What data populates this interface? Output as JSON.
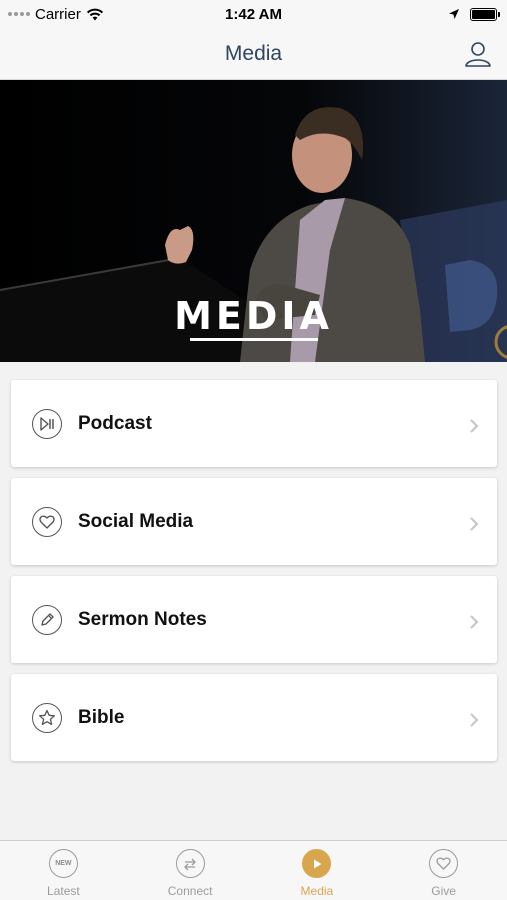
{
  "status_bar": {
    "carrier": "Carrier",
    "time": "1:42 AM"
  },
  "nav": {
    "title": "Media",
    "profile_icon": "person-icon"
  },
  "hero": {
    "title": "MEDIA"
  },
  "menu": {
    "items": [
      {
        "label": "Podcast",
        "icon": "play-pause-icon"
      },
      {
        "label": "Social Media",
        "icon": "heart-icon"
      },
      {
        "label": "Sermon Notes",
        "icon": "pencil-icon"
      },
      {
        "label": "Bible",
        "icon": "star-icon"
      }
    ]
  },
  "tabs": {
    "items": [
      {
        "label": "Latest",
        "icon": "new-badge-icon",
        "badge_text": "NEW",
        "active": false
      },
      {
        "label": "Connect",
        "icon": "exchange-arrows-icon",
        "active": false
      },
      {
        "label": "Media",
        "icon": "play-icon",
        "active": true
      },
      {
        "label": "Give",
        "icon": "heart-icon",
        "active": false
      }
    ]
  },
  "colors": {
    "accent": "#d9a64e",
    "nav_title": "#2f4560",
    "tab_inactive": "#9b9b9b"
  }
}
